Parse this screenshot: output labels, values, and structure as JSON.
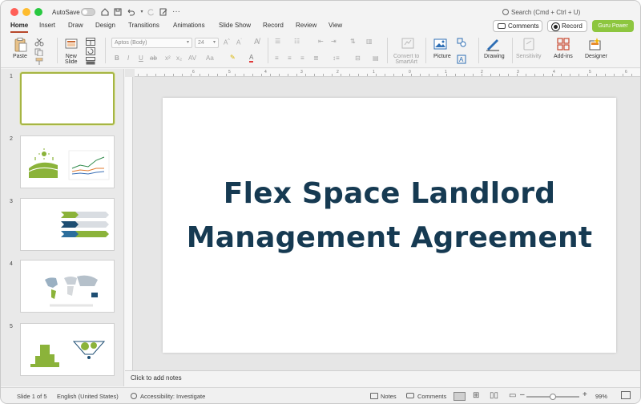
{
  "window": {
    "autosave_label": "AutoSave",
    "search_placeholder": "Search (Cmd + Ctrl + U)"
  },
  "tabs": [
    {
      "label": "Home",
      "active": true
    },
    {
      "label": "Insert"
    },
    {
      "label": "Draw"
    },
    {
      "label": "Design"
    },
    {
      "label": "Transitions"
    },
    {
      "label": "Animations"
    },
    {
      "label": "Slide Show"
    },
    {
      "label": "Record"
    },
    {
      "label": "Review"
    },
    {
      "label": "View"
    }
  ],
  "header_buttons": {
    "comments": "Comments",
    "record": "Record",
    "guru": "Guru Power"
  },
  "ribbon": {
    "paste": "Paste",
    "new_slide": "New\nSlide",
    "font_name": "Aptos (Body)",
    "font_size": "24",
    "convert_smartart": "Convert to\nSmartArt",
    "picture": "Picture",
    "drawing": "Drawing",
    "sensitivity": "Sensitivity",
    "add_ins": "Add-ins",
    "designer": "Designer"
  },
  "thumbnails": [
    {
      "number": "1",
      "selected": true
    },
    {
      "number": "2"
    },
    {
      "number": "3"
    },
    {
      "number": "4"
    },
    {
      "number": "5"
    }
  ],
  "slide": {
    "title_line1": "Flex Space Landlord",
    "title_line2": "Management Agreement"
  },
  "notes_placeholder": "Click to add notes",
  "ruler_numbers": [
    "6",
    "5",
    "4",
    "3",
    "2",
    "1",
    "0",
    "1",
    "2",
    "3",
    "4",
    "5",
    "6"
  ],
  "status": {
    "slide_info": "Slide 1 of 5",
    "language": "English (United States)",
    "accessibility": "Accessibility: Investigate",
    "notes": "Notes",
    "comments": "Comments",
    "zoom": "99%",
    "zoom_level": 0.5
  },
  "colors": {
    "title": "#163a52",
    "accent_tab": "#b7472a",
    "guru_button": "#8dc63f",
    "thumb_selected": "#a6b543"
  }
}
